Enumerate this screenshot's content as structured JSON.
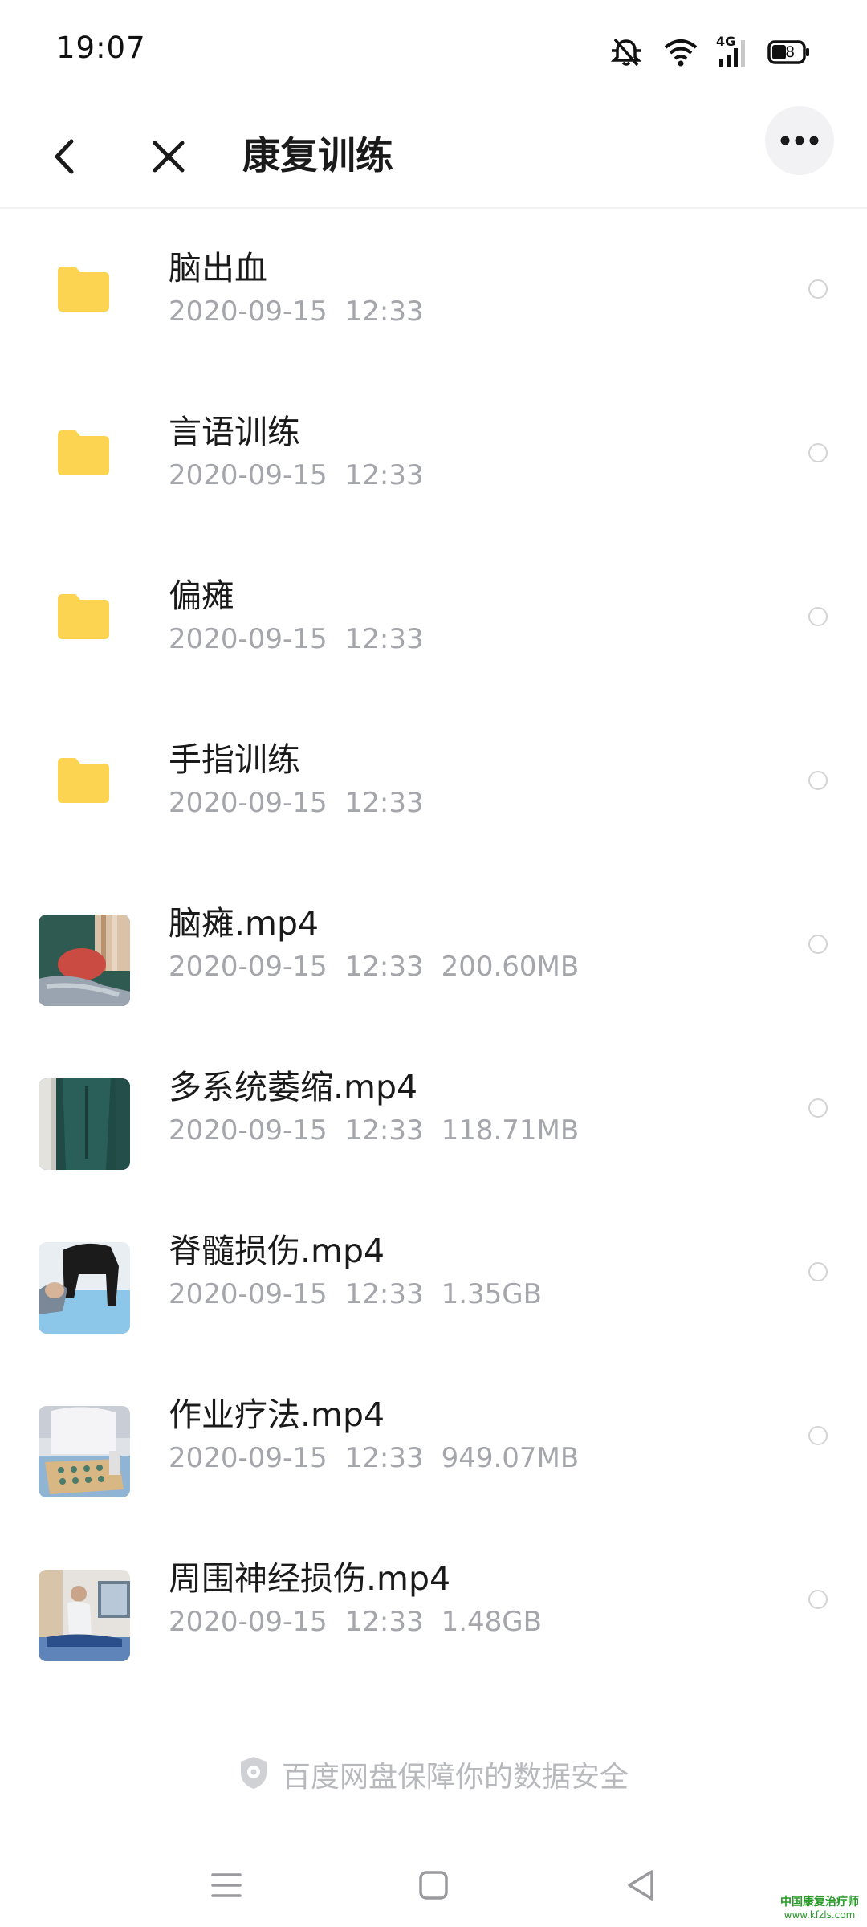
{
  "status_bar": {
    "time": "19:07",
    "network": "4G",
    "battery": "38",
    "icons": [
      "mute-bell-icon",
      "wifi-icon",
      "cellular-signal-icon",
      "battery-icon"
    ]
  },
  "nav": {
    "title": "康复训练",
    "icons": [
      "back-arrow-icon",
      "close-icon",
      "more-icon"
    ]
  },
  "files": [
    {
      "name": "脑出血",
      "date": "2020-09-15",
      "time": "12:33",
      "size": "",
      "type": "folder"
    },
    {
      "name": "言语训练",
      "date": "2020-09-15",
      "time": "12:33",
      "size": "",
      "type": "folder"
    },
    {
      "name": "偏瘫",
      "date": "2020-09-15",
      "time": "12:33",
      "size": "",
      "type": "folder"
    },
    {
      "name": "手指训练",
      "date": "2020-09-15",
      "time": "12:33",
      "size": "",
      "type": "folder"
    },
    {
      "name": "脑瘫.mp4",
      "date": "2020-09-15",
      "time": "12:33",
      "size": "200.60MB",
      "type": "video"
    },
    {
      "name": "多系统萎缩.mp4",
      "date": "2020-09-15",
      "time": "12:33",
      "size": "118.71MB",
      "type": "video"
    },
    {
      "name": "脊髓损伤.mp4",
      "date": "2020-09-15",
      "time": "12:33",
      "size": "1.35GB",
      "type": "video"
    },
    {
      "name": "作业疗法.mp4",
      "date": "2020-09-15",
      "time": "12:33",
      "size": "949.07MB",
      "type": "video"
    },
    {
      "name": "周围神经损伤.mp4",
      "date": "2020-09-15",
      "time": "12:33",
      "size": "1.48GB",
      "type": "video"
    }
  ],
  "footer": {
    "security_text": "百度网盘保障你的数据安全",
    "icon": "shield-icon"
  },
  "system_nav": {
    "icons": [
      "menu-icon",
      "home-icon",
      "back-triangle-icon"
    ]
  },
  "watermark": {
    "line1": "中国康复治疗师",
    "line2": "www.kfzls.com"
  },
  "colors": {
    "folder": "#fdd452",
    "meta_text": "#a4a6ab",
    "title_text": "#1a1a1a"
  }
}
